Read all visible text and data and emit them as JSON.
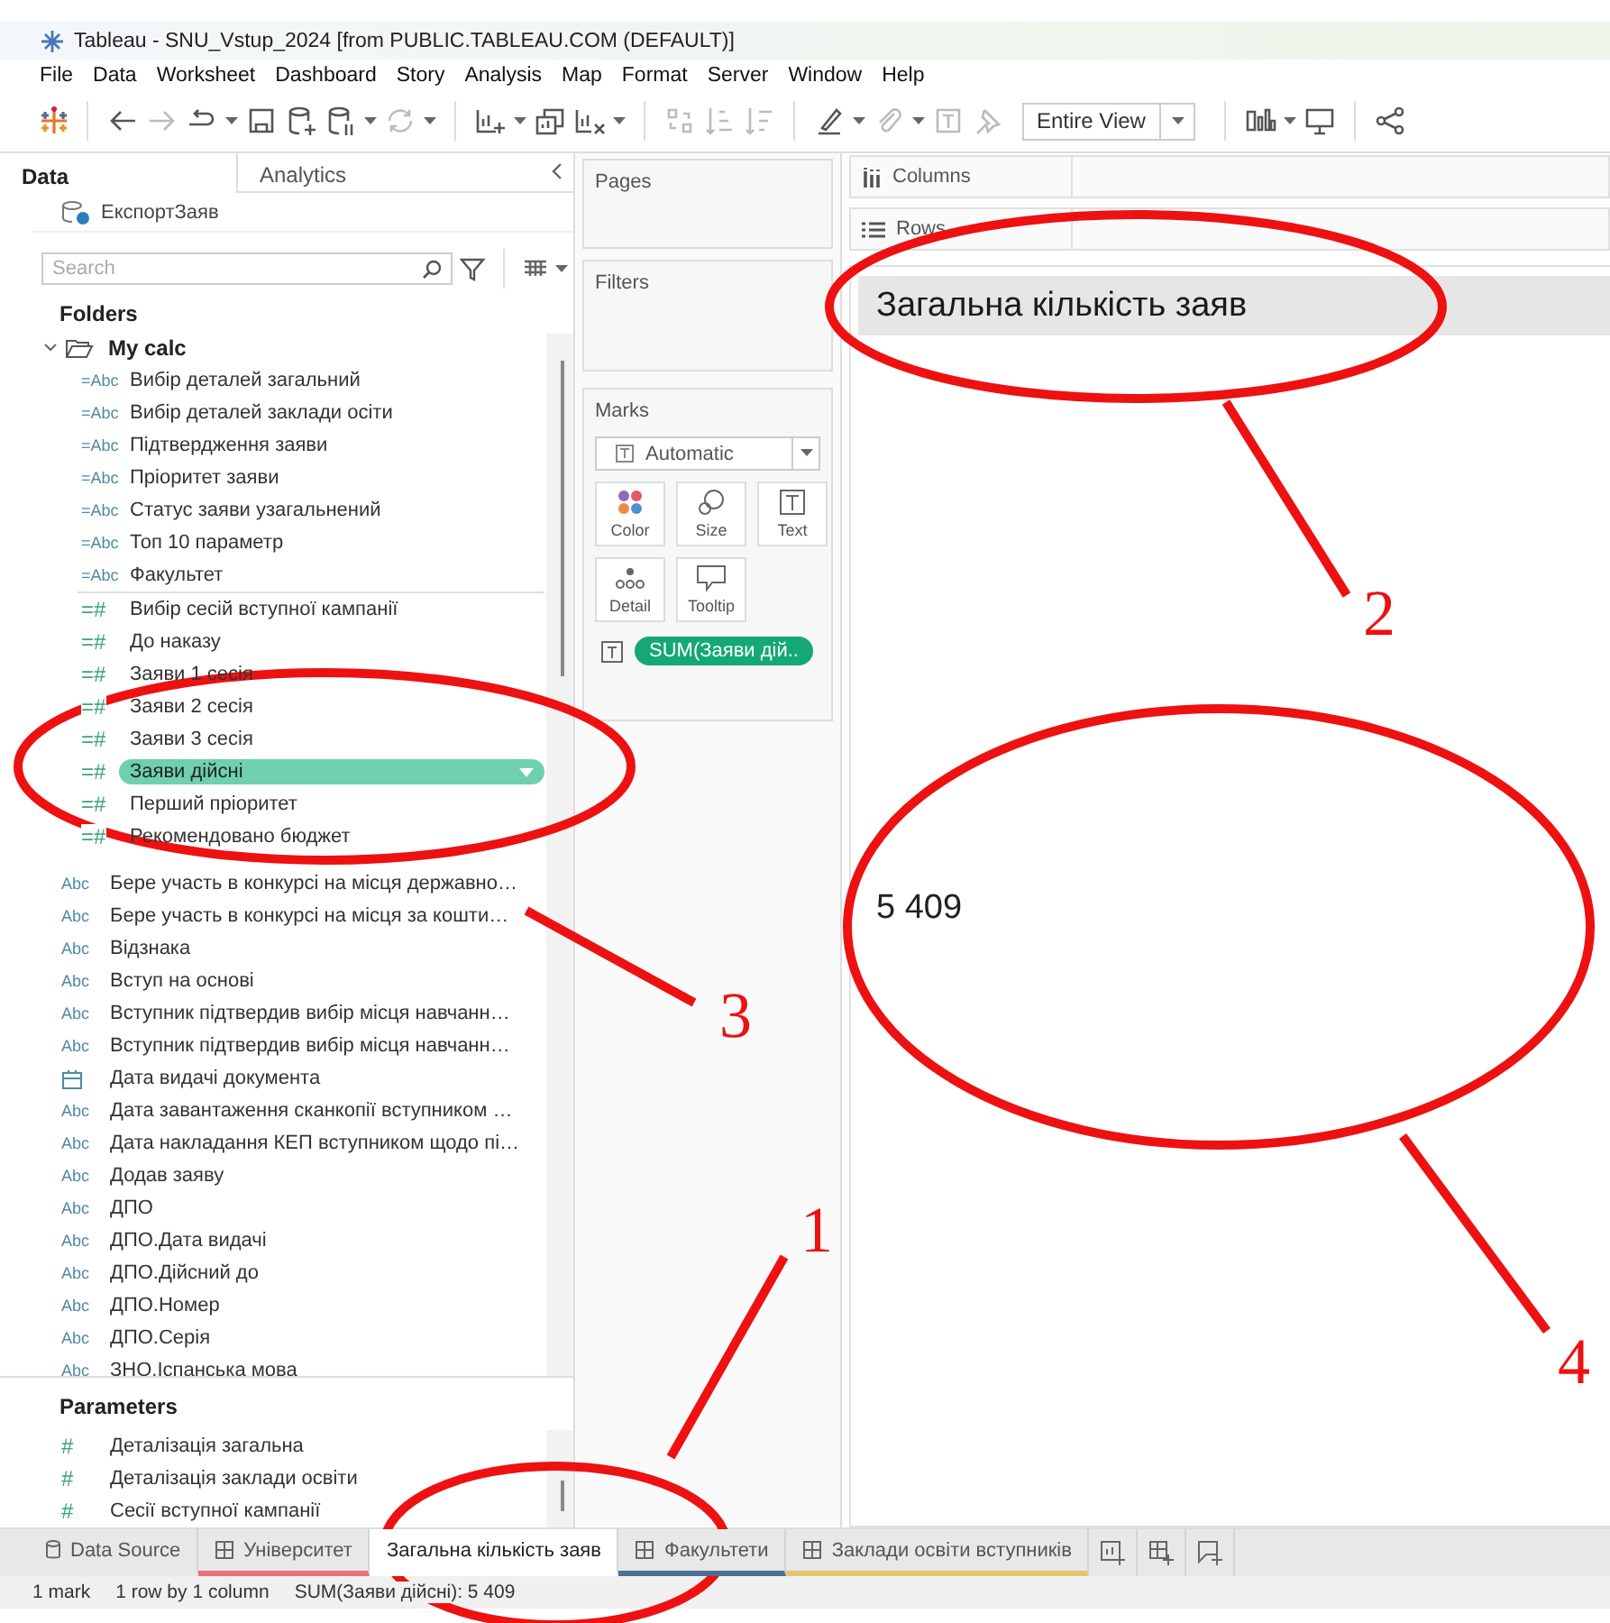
{
  "window": {
    "title": "Tableau - SNU_Vstup_2024 [from PUBLIC.TABLEAU.COM (DEFAULT)]"
  },
  "menu": [
    "File",
    "Data",
    "Worksheet",
    "Dashboard",
    "Story",
    "Analysis",
    "Map",
    "Format",
    "Server",
    "Window",
    "Help"
  ],
  "toolbar": {
    "view_fit": "Entire View"
  },
  "data_pane": {
    "tabs": [
      {
        "label": "Data",
        "selected": true
      },
      {
        "label": "Analytics",
        "selected": false
      }
    ],
    "datasource": "ЕкспортЗаяв",
    "search": {
      "placeholder": "Search"
    },
    "folders_heading": "Folders",
    "folders": [
      {
        "name": "My calc",
        "expanded": true,
        "children": [
          {
            "name": "Вибір деталей загальний",
            "kind": "string",
            "icon": "=Abc",
            "selected": false
          },
          {
            "name": "Вибір деталей заклади осіти",
            "kind": "string",
            "icon": "=Abc",
            "selected": false
          },
          {
            "name": "Підтвердження заяви",
            "kind": "string",
            "icon": "=Abc",
            "selected": false
          },
          {
            "name": "Пріоритет заяви",
            "kind": "string",
            "icon": "=Abc",
            "selected": false
          },
          {
            "name": "Статус заяви узагальнений",
            "kind": "string",
            "icon": "=Abc",
            "selected": false
          },
          {
            "name": "Топ 10 параметр",
            "kind": "string",
            "icon": "=Abc",
            "selected": false
          },
          {
            "name": "Факультет",
            "kind": "string",
            "icon": "=Abc",
            "selected": false
          },
          {
            "name": "Вибір сесій вступної кампанії",
            "kind": "number",
            "icon": "=#",
            "selected": false
          },
          {
            "name": "До наказу",
            "kind": "number",
            "icon": "=#",
            "selected": false
          },
          {
            "name": "Заяви 1 сесія",
            "kind": "number",
            "icon": "=#",
            "selected": false
          },
          {
            "name": "Заяви 2 сесія",
            "kind": "number",
            "icon": "=#",
            "selected": false
          },
          {
            "name": "Заяви 3 сесія",
            "kind": "number",
            "icon": "=#",
            "selected": false
          },
          {
            "name": "Заяви дійсні",
            "kind": "number",
            "icon": "=#",
            "selected": true
          },
          {
            "name": "Перший пріоритет",
            "kind": "number",
            "icon": "=#",
            "selected": false
          },
          {
            "name": "Рекомендовано бюджет",
            "kind": "number",
            "icon": "=#",
            "selected": false
          }
        ]
      }
    ],
    "fields": [
      {
        "name": "Бере участь в конкурсі на місця державно…",
        "kind": "string",
        "icon": "Abc"
      },
      {
        "name": "Бере участь в конкурсі на місця за кошти…",
        "kind": "string",
        "icon": "Abc"
      },
      {
        "name": "Відзнака",
        "kind": "string",
        "icon": "Abc"
      },
      {
        "name": "Вступ на основі",
        "kind": "string",
        "icon": "Abc"
      },
      {
        "name": "Вступник підтвердив вибір місця навчанн…",
        "kind": "string",
        "icon": "Abc"
      },
      {
        "name": "Вступник підтвердив вибір місця навчанн…",
        "kind": "string",
        "icon": "Abc"
      },
      {
        "name": "Дата видачі документа",
        "kind": "date"
      },
      {
        "name": "Дата завантаження сканкопії вступником …",
        "kind": "string",
        "icon": "Abc"
      },
      {
        "name": "Дата накладання КЕП вступником щодо пі…",
        "kind": "string",
        "icon": "Abc"
      },
      {
        "name": "Додав заяву",
        "kind": "string",
        "icon": "Abc"
      },
      {
        "name": "ДПО",
        "kind": "string",
        "icon": "Abc"
      },
      {
        "name": "ДПО.Дата видачі",
        "kind": "string",
        "icon": "Abc"
      },
      {
        "name": "ДПО.Дійсний до",
        "kind": "string",
        "icon": "Abc"
      },
      {
        "name": "ДПО.Номер",
        "kind": "string",
        "icon": "Abc"
      },
      {
        "name": "ДПО.Серія",
        "kind": "string",
        "icon": "Abc"
      },
      {
        "name": "ЗНО.Іспанська мова",
        "kind": "string",
        "icon": "Abc"
      }
    ],
    "parameters_heading": "Parameters",
    "parameters": [
      {
        "name": "Деталізація загальна",
        "icon": "#"
      },
      {
        "name": "Деталізація заклади освіти",
        "icon": "#"
      },
      {
        "name": "Сесії вступної кампанії",
        "icon": "#"
      }
    ]
  },
  "shelves": {
    "pages": "Pages",
    "filters": "Filters",
    "columns": "Columns",
    "rows": "Rows",
    "marks": {
      "title": "Marks",
      "type": "Automatic",
      "cards": [
        {
          "label": "Color",
          "kind": "color"
        },
        {
          "label": "Size",
          "kind": "size"
        },
        {
          "label": "Text",
          "kind": "text"
        },
        {
          "label": "Detail",
          "kind": "detail"
        },
        {
          "label": "Tooltip",
          "kind": "tooltip"
        }
      ],
      "fields": [
        {
          "label": "SUM(Заяви дій..",
          "kind": "text"
        }
      ]
    }
  },
  "view": {
    "title": "Загальна кількість заяв",
    "value": "5 409"
  },
  "sheet_tabs": [
    {
      "label": "Data Source",
      "kind": "datasource",
      "selected": false
    },
    {
      "label": "Університет",
      "kind": "worksheet",
      "selected": false,
      "color": "#e8707a"
    },
    {
      "label": "Загальна кількість заяв",
      "kind": "plain",
      "selected": true
    },
    {
      "label": "Факультети",
      "kind": "worksheet",
      "selected": false,
      "color": "#4e6e96"
    },
    {
      "label": "Заклади освіти вступників",
      "kind": "worksheet",
      "selected": false,
      "color": "#e3c56e"
    }
  ],
  "status_bar": [
    "1 mark",
    "1 row by 1 column",
    "SUM(Заяви дійсні): 5 409"
  ],
  "annotations": [
    {
      "label": "1"
    },
    {
      "label": "2"
    },
    {
      "label": "3"
    },
    {
      "label": "4"
    }
  ]
}
